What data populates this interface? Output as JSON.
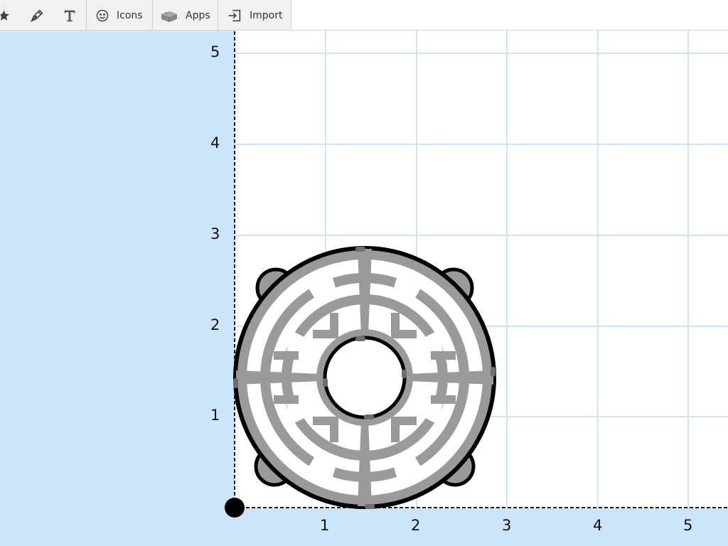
{
  "toolbar": {
    "icons_label": "Icons",
    "apps_label": "Apps",
    "import_label": "Import"
  },
  "axes": {
    "y_ticks": [
      "5",
      "4",
      "3",
      "2",
      "1"
    ],
    "x_ticks": [
      "1",
      "2",
      "3",
      "4",
      "5"
    ]
  },
  "colors": {
    "panel_bg": "#cce5fa",
    "grid_line": "#cfe3f5",
    "shape_gray": "#9a9a9a",
    "shape_outline": "#000000"
  }
}
